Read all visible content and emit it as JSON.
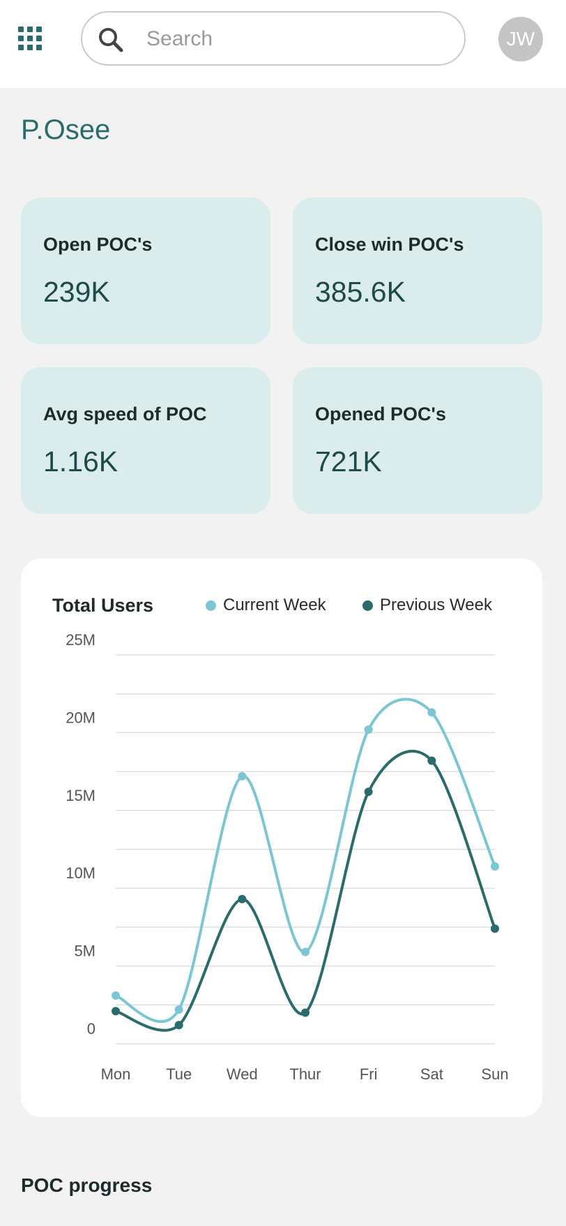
{
  "header": {
    "menu_icon": "grid-icon",
    "search_icon": "search-icon",
    "search_placeholder": "Search",
    "search_value": "",
    "avatar_initials": "JW"
  },
  "page": {
    "title": "P.Osee"
  },
  "stats": [
    {
      "label": "Open POC's",
      "value": "239K"
    },
    {
      "label": "Close win POC's",
      "value": "385.6K"
    },
    {
      "label": "Avg speed of POC",
      "value": "1.16K"
    },
    {
      "label": "Opened POC's",
      "value": "721K"
    }
  ],
  "colors": {
    "accent": "#2a6b6b",
    "card_bg": "#dbecec",
    "current_week": "#7cc6d4",
    "previous_week": "#2a6b6b"
  },
  "chart_data": {
    "type": "line",
    "title": "Total Users",
    "categories": [
      "Mon",
      "Tue",
      "Wed",
      "Thur",
      "Fri",
      "Sat",
      "Sun"
    ],
    "y_tick_labels": [
      "0",
      "5M",
      "10M",
      "15M",
      "20M",
      "25M"
    ],
    "y_ticks": [
      0,
      5,
      10,
      15,
      20,
      25
    ],
    "ylim": [
      0,
      25
    ],
    "grid": true,
    "legend_position": "top-right",
    "series": [
      {
        "name": "Current Week",
        "values": [
          3.1,
          2.2,
          17.2,
          5.9,
          20.2,
          21.3,
          11.4
        ]
      },
      {
        "name": "Previous Week",
        "values": [
          2.1,
          1.2,
          9.3,
          2.0,
          16.2,
          18.2,
          7.4
        ]
      }
    ]
  },
  "sections": {
    "progress_title": "POC progress"
  }
}
